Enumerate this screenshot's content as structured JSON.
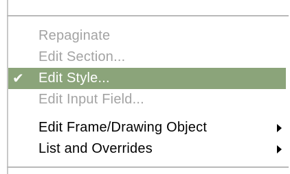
{
  "menu": {
    "items": [
      {
        "label": "Repaginate",
        "state": "disabled"
      },
      {
        "label": "Edit Section...",
        "state": "disabled"
      },
      {
        "label": "Edit Style...",
        "state": "selected",
        "checked": true,
        "check_glyph": "✔"
      },
      {
        "label": "Edit Input Field...",
        "state": "disabled"
      },
      {
        "label": "Edit Frame/Drawing Object",
        "state": "enabled",
        "submenu": true
      },
      {
        "label": "List and Overrides",
        "state": "enabled",
        "submenu": true
      }
    ]
  },
  "colors": {
    "highlight": "#8ba47a",
    "disabled_text": "#a3a3a3",
    "enabled_text": "#000000",
    "separator": "#b9b9b9"
  }
}
